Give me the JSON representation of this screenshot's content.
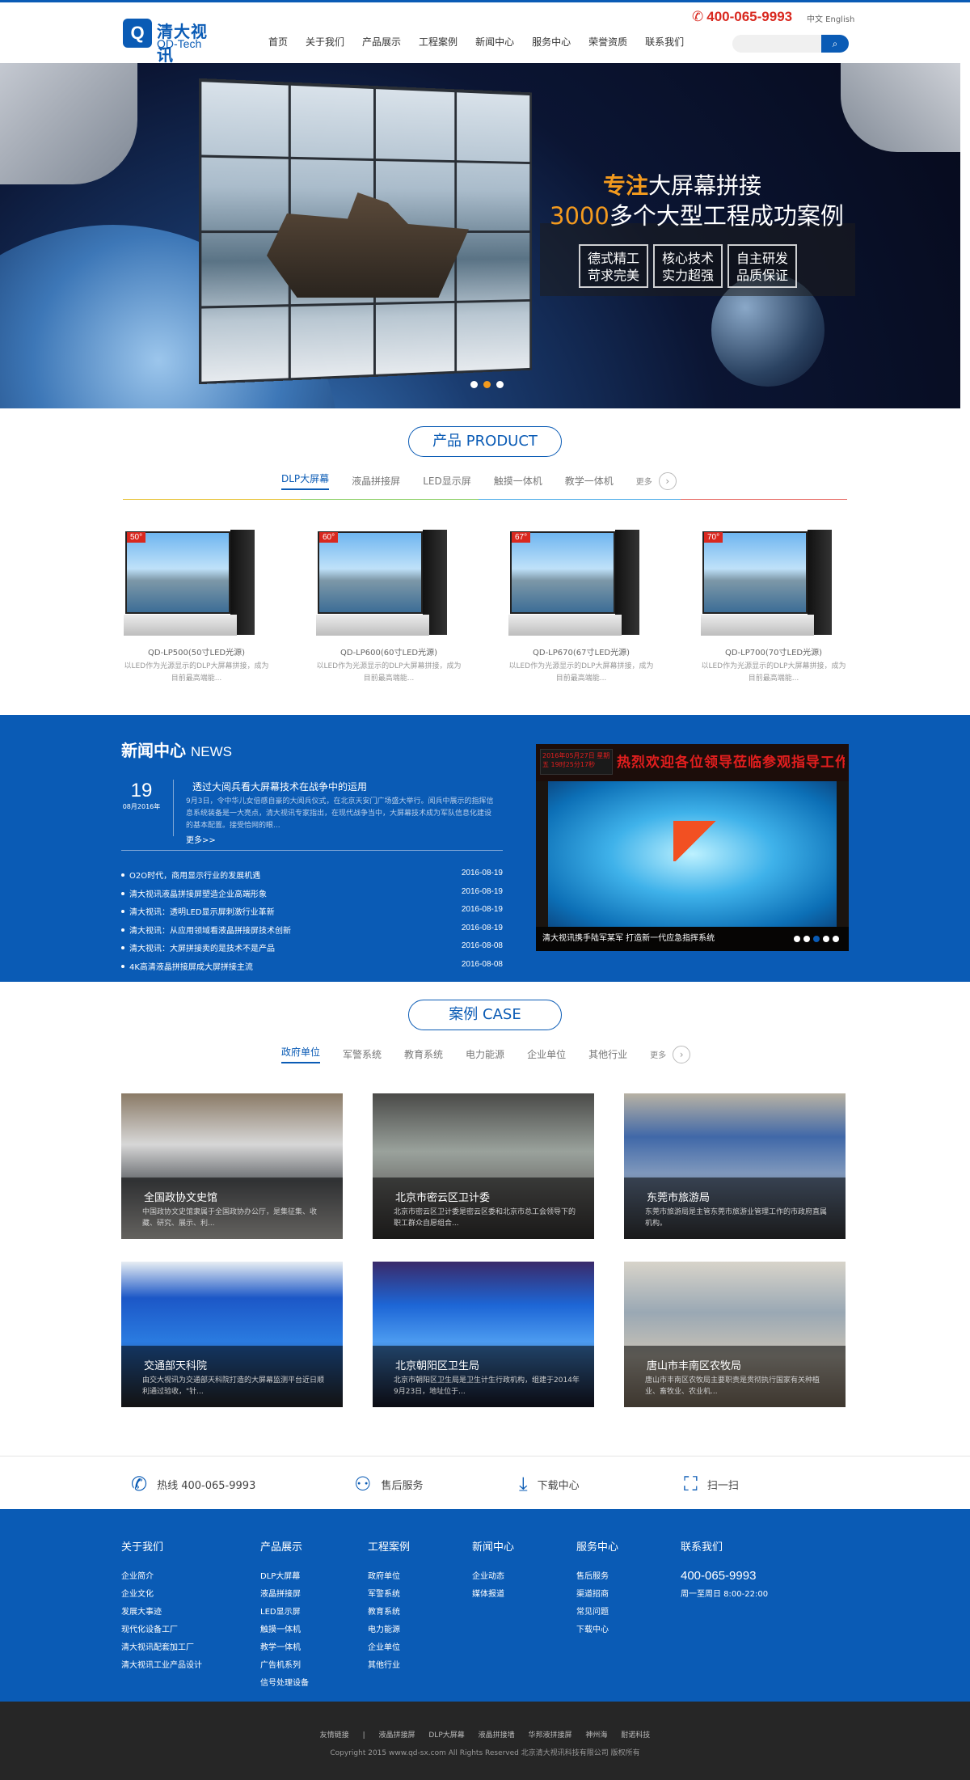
{
  "header": {
    "logo_cn": "清大视讯",
    "logo_en": "QD-Tech",
    "hotline": "400-065-9993",
    "lang": "中文 English",
    "nav": [
      "首页",
      "关于我们",
      "产品展示",
      "工程案例",
      "新闻中心",
      "服务中心",
      "荣誉资质",
      "联系我们"
    ],
    "search_placeholder": ""
  },
  "banner": {
    "line1_highlight": "专注",
    "line1_rest": "大屏幕拼接",
    "line2_highlight": "3000",
    "line2_rest": "多个大型工程成功案例",
    "tags": [
      [
        "德式精工",
        "苛求完美"
      ],
      [
        "核心技术",
        "实力超强"
      ],
      [
        "自主研发",
        "品质保证"
      ]
    ],
    "active_dot": 1
  },
  "product": {
    "title": "产品 PRODUCT",
    "tabs": [
      "DLP大屏幕",
      "液晶拼接屏",
      "LED显示屏",
      "触摸一体机",
      "教学一体机"
    ],
    "more": "更多",
    "line_colors": [
      "#e8c43a",
      "#8fd16a",
      "#5ab2ea",
      "#e8706a"
    ],
    "items": [
      {
        "badge": "50°",
        "name": "QD-LP500(50寸LED光源)",
        "desc": "以LED作为光源显示的DLP大屏幕拼接，成为目前最高端能..."
      },
      {
        "badge": "60°",
        "name": "QD-LP600(60寸LED光源)",
        "desc": "以LED作为光源显示的DLP大屏幕拼接，成为目前最高端能..."
      },
      {
        "badge": "67°",
        "name": "QD-LP670(67寸LED光源)",
        "desc": "以LED作为光源显示的DLP大屏幕拼接，成为目前最高端能..."
      },
      {
        "badge": "70°",
        "name": "QD-LP700(70寸LED光源)",
        "desc": "以LED作为光源显示的DLP大屏幕拼接，成为目前最高端能..."
      }
    ]
  },
  "news": {
    "title": "新闻中心",
    "title_en": "NEWS",
    "featured": {
      "day": "19",
      "month": "08月2016年",
      "headline": "透过大阅兵看大屏幕技术在战争中的运用",
      "summary": "9月3日，令中华儿女倍感自豪的大阅兵仪式，在北京天安门广场盛大举行。阅兵中展示的指挥信息系统装备是一大亮点，清大视讯专家指出，在现代战争当中，大屏幕技术成为军队信息化建设的基本配置。接受恰网的眼...",
      "more": "更多>>"
    },
    "list": [
      {
        "title": "O2O时代，商用显示行业的发展机遇",
        "date": "2016-08-19"
      },
      {
        "title": "清大视讯液晶拼接屏塑造企业高端形象",
        "date": "2016-08-19"
      },
      {
        "title": "清大视讯：透明LED显示屏刺激行业革新",
        "date": "2016-08-19"
      },
      {
        "title": "清大视讯：从应用领域看液晶拼接屏技术创新",
        "date": "2016-08-19"
      },
      {
        "title": "清大视讯：大屏拼接卖的是技术不是产品",
        "date": "2016-08-08"
      },
      {
        "title": "4K高清液晶拼接屏成大屏拼接主流",
        "date": "2016-08-08"
      }
    ],
    "photo_led": "热烈欢迎各位领导莅临参观指导工作",
    "photo_red": "2016年05月27日 星期五 19时25分17秒",
    "photo_caption": "清大视讯携手陆军某军 打造新一代应急指挥系统",
    "dots": 5,
    "active_dot": 2
  },
  "cases": {
    "title": "案例 CASE",
    "tabs": [
      "政府单位",
      "军警系统",
      "教育系统",
      "电力能源",
      "企业单位",
      "其他行业"
    ],
    "more": "更多",
    "items": [
      {
        "title": "全国政协文史馆",
        "desc": "中国政协文史馆隶属于全国政协办公厅，是集征集、收藏、研究、展示、利...",
        "bg": "linear-gradient(180deg,#8a7a66 0%,#d7d7d7 35%,#6b6e72 60%,#ddd9d2 100%)"
      },
      {
        "title": "北京市密云区卫计委",
        "desc": "北京市密云区卫计委是密云区委和北京市总工会领导下的职工群众自愿组合...",
        "bg": "linear-gradient(180deg,#4a4a48 0%,#9aa29c 40%,#6b6a68 70%,#3a3836 100%)"
      },
      {
        "title": "东莞市旅游局",
        "desc": "东莞市旅游局是主管东莞市旅游业管理工作的市政府直属机构。",
        "bg": "linear-gradient(180deg,#b8b2a4 0%,#4068a8 30%,#7f98bc 55%,#3a3a3c 100%)"
      },
      {
        "title": "交通部天科院",
        "desc": "由交大视讯为交通部天科院打造的大屏幕监测平台近日顺利通过验收，\"针...",
        "bg": "linear-gradient(180deg,#e8eef4 0%,#1c57c7 25%,#2a7be0 55%,#2a2a2a 100%)"
      },
      {
        "title": "北京朝阳区卫生局",
        "desc": "北京市朝阳区卫生局是卫生计生行政机构，组建于2014年9月23日，地址位于...",
        "bg": "linear-gradient(180deg,#3a2a6a 0%,#1d66d6 30%,#4c9bf0 55%,#1a1a2a 100%)"
      },
      {
        "title": "唐山市丰南区农牧局",
        "desc": "唐山市丰南区农牧局主要职责是贯彻执行国家有关种植业、畜牧业、农业机...",
        "bg": "linear-gradient(180deg,#d8d4ca 0%,#9aa8b4 35%,#c8c2b6 65%,#8a7a68 100%)"
      }
    ]
  },
  "service": [
    {
      "icon": "phone-icon",
      "label": "热线 400-065-9993"
    },
    {
      "icon": "user-icon",
      "label": "售后服务"
    },
    {
      "icon": "download-icon",
      "label": "下载中心"
    },
    {
      "icon": "scan-icon",
      "label": "扫一扫"
    }
  ],
  "footer": {
    "cols": [
      {
        "title": "关于我们",
        "items": [
          "企业简介",
          "企业文化",
          "发展大事迹",
          "现代化设备工厂",
          "清大视讯配套加工厂",
          "清大视讯工业产品设计"
        ]
      },
      {
        "title": "产品展示",
        "items": [
          "DLP大屏幕",
          "液晶拼接屏",
          "LED显示屏",
          "触摸一体机",
          "教学一体机",
          "广告机系列",
          "信号处理设备"
        ]
      },
      {
        "title": "工程案例",
        "items": [
          "政府单位",
          "军警系统",
          "教育系统",
          "电力能源",
          "企业单位",
          "其他行业"
        ]
      },
      {
        "title": "新闻中心",
        "items": [
          "企业动态",
          "媒体报道"
        ]
      },
      {
        "title": "服务中心",
        "items": [
          "售后服务",
          "渠道招商",
          "常见问题",
          "下载中心"
        ]
      }
    ],
    "contact_title": "联系我们",
    "contact_tel": "400-065-9993",
    "contact_hours": "周一至周日 8:00-22:00",
    "links": [
      "友情链接",
      "|",
      "液晶拼接屏",
      "DLP大屏幕",
      "液晶拼接墙",
      "华邦液拼接屏",
      "神州海",
      "耐诺科技"
    ],
    "copyright": "Copyright 2015 www.qd-sx.com All Rights Reserved 北京清大视讯科技有限公司 版权所有"
  }
}
